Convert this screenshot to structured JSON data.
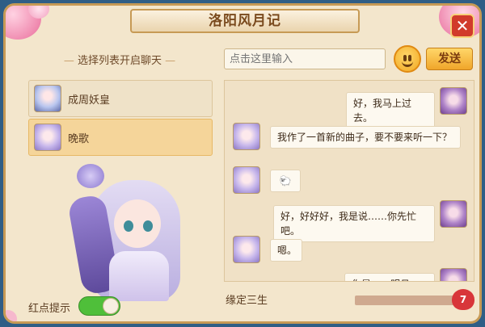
{
  "window": {
    "title": "洛阳风月记",
    "close_glyph": "✕"
  },
  "left_panel": {
    "header": "选择列表开启聊天",
    "contacts": [
      {
        "name": "成周妖皇",
        "avatar_icon": "zhou-avatar",
        "selected": false
      },
      {
        "name": "晚歌",
        "avatar_icon": "wange-avatar",
        "selected": true
      }
    ],
    "red_dot_toggle": {
      "label": "红点提示",
      "on": true
    }
  },
  "composer": {
    "placeholder": "点击这里输入",
    "send_label": "发送",
    "emoji_icon": "smiley-icon"
  },
  "messages": [
    {
      "from": "me",
      "text": "好，我马上过去。"
    },
    {
      "from": "wange",
      "text": "我作了一首新的曲子，要不要来听一下？"
    },
    {
      "from": "wange",
      "text": "🐑",
      "sticker": true
    },
    {
      "from": "me",
      "text": "好，好好好，我是说……你先忙吧。"
    },
    {
      "from": "wange",
      "text": "嗯。"
    },
    {
      "from": "me",
      "text": "你是……明月姬？"
    }
  ],
  "affinity": {
    "label": "缘定三生",
    "level": "7",
    "progress_fraction": 0.96,
    "heart_color": "#d8363a"
  },
  "colors": {
    "accent": "#f0a52a",
    "panel": "#f3e6cc",
    "toggle_on": "#4fbf3a"
  }
}
